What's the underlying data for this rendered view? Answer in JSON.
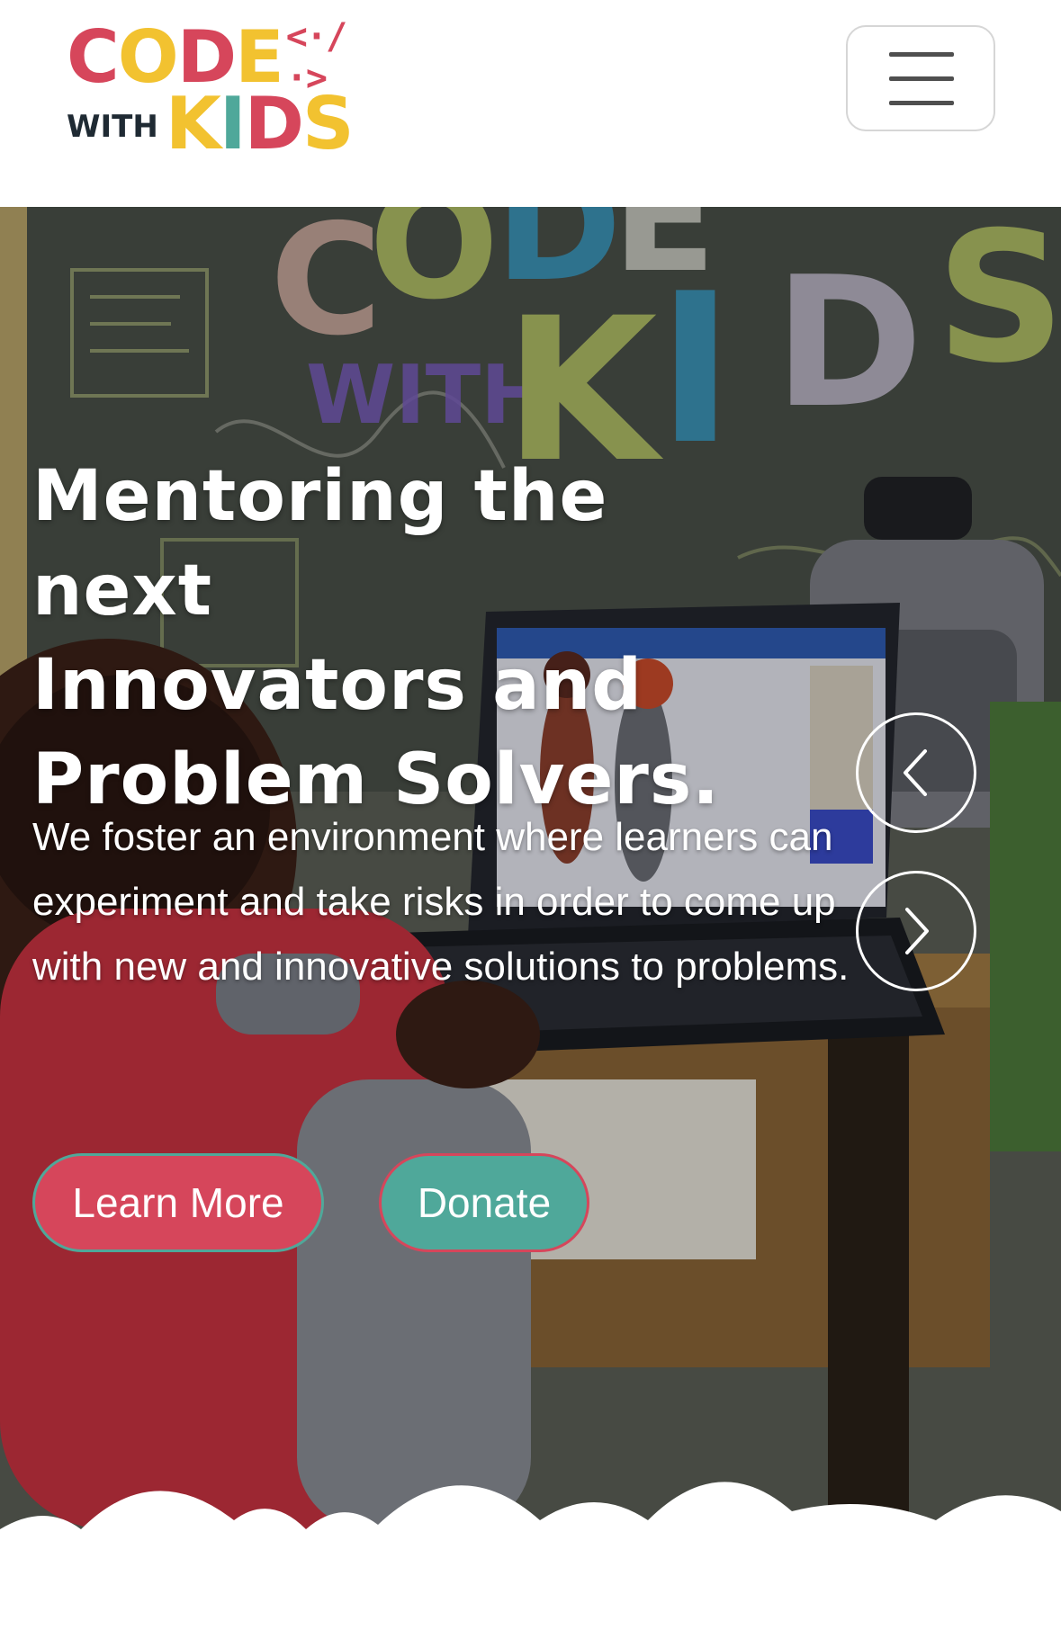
{
  "header": {
    "logo": {
      "row1_letters": [
        {
          "char": "C",
          "color": "#d6465b"
        },
        {
          "char": "O",
          "color": "#f2c230"
        },
        {
          "char": "D",
          "color": "#d6465b"
        },
        {
          "char": "E",
          "color": "#f2c230"
        }
      ],
      "code_symbol": "<·/·>",
      "code_symbol_color": "#d6465b",
      "with_text": "WITH",
      "row2_letters": [
        {
          "char": "K",
          "color": "#f2c230"
        },
        {
          "char": "I",
          "color": "#4fa89a"
        },
        {
          "char": "D",
          "color": "#d6465b"
        },
        {
          "char": "S",
          "color": "#f2c230"
        }
      ]
    },
    "menu_icon": "hamburger-icon"
  },
  "hero": {
    "title_lines": [
      "Mentoring the next",
      "Innovators and",
      "Problem Solvers."
    ],
    "description": "We foster an environment where learners can experiment and take risks in order to come up with new and innovative solutions to problems.",
    "buttons": {
      "learn_more": "Learn More",
      "donate": "Donate"
    },
    "carousel": {
      "prev_icon": "chevron-left-icon",
      "next_icon": "chevron-right-icon"
    },
    "background": {
      "chalkboard_letters": [
        "C",
        "O",
        "D",
        "E",
        "W",
        "I",
        "T",
        "H",
        "K",
        "I",
        "D",
        "S"
      ]
    }
  },
  "colors": {
    "brand_red": "#d6465b",
    "brand_teal": "#4fa89a",
    "brand_yellow": "#f2c230",
    "brand_dark": "#1f2a33"
  }
}
